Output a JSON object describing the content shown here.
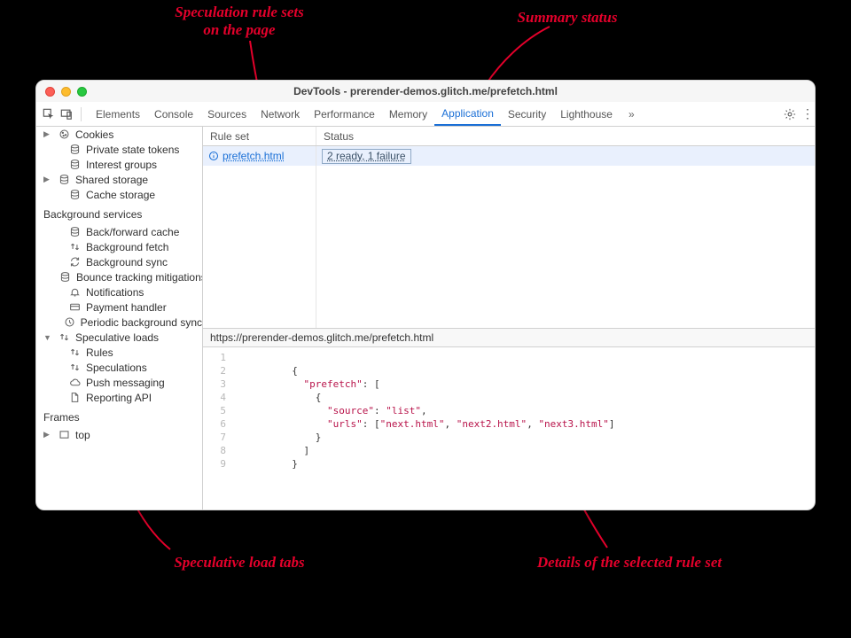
{
  "window_title": "DevTools - prerender-demos.glitch.me/prefetch.html",
  "tabs": [
    "Elements",
    "Console",
    "Sources",
    "Network",
    "Performance",
    "Memory",
    "Application",
    "Security",
    "Lighthouse"
  ],
  "active_tab": "Application",
  "sidebar": {
    "items_top": [
      {
        "label": "Cookies",
        "icon": "cookie",
        "arrow": true
      },
      {
        "label": "Private state tokens",
        "icon": "db"
      },
      {
        "label": "Interest groups",
        "icon": "db"
      },
      {
        "label": "Shared storage",
        "icon": "db",
        "arrow": true
      },
      {
        "label": "Cache storage",
        "icon": "db"
      }
    ],
    "group_bg": "Background services",
    "items_bg": [
      {
        "label": "Back/forward cache",
        "icon": "db"
      },
      {
        "label": "Background fetch",
        "icon": "updown"
      },
      {
        "label": "Background sync",
        "icon": "sync"
      },
      {
        "label": "Bounce tracking mitigations",
        "icon": "db"
      },
      {
        "label": "Notifications",
        "icon": "bell"
      },
      {
        "label": "Payment handler",
        "icon": "card"
      },
      {
        "label": "Periodic background sync",
        "icon": "clock"
      },
      {
        "label": "Speculative loads",
        "icon": "updown",
        "arrow": true,
        "open": true
      }
    ],
    "spec_children": [
      {
        "label": "Rules",
        "icon": "updown"
      },
      {
        "label": "Speculations",
        "icon": "updown"
      }
    ],
    "after_spec": [
      {
        "label": "Push messaging",
        "icon": "cloud"
      },
      {
        "label": "Reporting API",
        "icon": "doc"
      }
    ],
    "group_frames": "Frames",
    "frames": [
      {
        "label": "top",
        "icon": "frame",
        "arrow": true
      }
    ]
  },
  "table": {
    "col1": "Rule set",
    "col2": "Status",
    "row1_ruleset": " prefetch.html",
    "row1_status": "2 ready, 1 failure"
  },
  "url_path": "https://prerender-demos.glitch.me/prefetch.html",
  "code_lines": [
    "1",
    "2",
    "3",
    "4",
    "5",
    "6",
    "7",
    "8",
    "9"
  ],
  "code": {
    "l2": "{",
    "l3a": "  \"prefetch\"",
    "l3b": ": [",
    "l4": "    {",
    "l5a": "      \"source\"",
    "l5b": ": ",
    "l5c": "\"list\"",
    "l5d": ",",
    "l6a": "      \"urls\"",
    "l6b": ": [",
    "l6c": "\"next.html\"",
    "l6d": ", ",
    "l6e": "\"next2.html\"",
    "l6f": ", ",
    "l6g": "\"next3.html\"",
    "l6h": "]",
    "l7": "    }",
    "l8": "  ]",
    "l9": "}"
  },
  "annotations": {
    "rulesets": "Speculation rule sets\non the page",
    "summary": "Summary status",
    "tabs": "Speculative load tabs",
    "details": "Details of the selected rule set"
  }
}
